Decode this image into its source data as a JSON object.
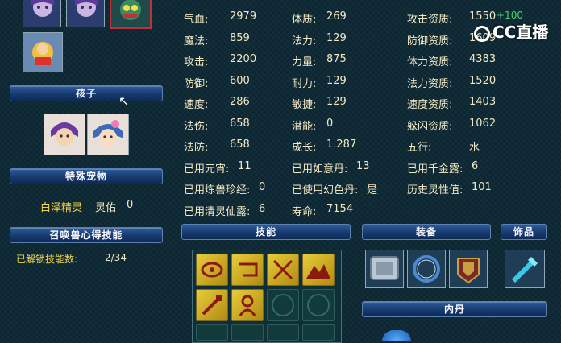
{
  "top_pet_tiles": [
    {
      "name": "pet-portrait-1"
    },
    {
      "name": "pet-portrait-2"
    },
    {
      "name": "pet-portrait-3-selected"
    },
    {
      "name": "pet-portrait-4"
    }
  ],
  "children_header": "孩子",
  "special_pet_header": "特殊宠物",
  "special_pet": {
    "name": "白泽精灵",
    "blessing_label": "灵佑",
    "blessing_value": "0"
  },
  "heart_skill_header": "召唤兽心得技能",
  "unlocked": {
    "label": "已解锁技能数:",
    "value": "2/34"
  },
  "stats_rows": [
    [
      {
        "label": "气血:",
        "value": "2979"
      },
      {
        "label": "体质:",
        "value": "269"
      },
      {
        "label": "攻击资质:",
        "value": "1550",
        "bonus": "+100"
      }
    ],
    [
      {
        "label": "魔法:",
        "value": "859"
      },
      {
        "label": "法力:",
        "value": "129"
      },
      {
        "label": "防御资质:",
        "value": "1609"
      }
    ],
    [
      {
        "label": "攻击:",
        "value": "2200"
      },
      {
        "label": "力量:",
        "value": "875"
      },
      {
        "label": "体力资质:",
        "value": "4383"
      }
    ],
    [
      {
        "label": "防御:",
        "value": "600"
      },
      {
        "label": "耐力:",
        "value": "129"
      },
      {
        "label": "法力资质:",
        "value": "1520"
      }
    ],
    [
      {
        "label": "速度:",
        "value": "286"
      },
      {
        "label": "敏捷:",
        "value": "129"
      },
      {
        "label": "速度资质:",
        "value": "1403"
      }
    ],
    [
      {
        "label": "法伤:",
        "value": "658"
      },
      {
        "label": "潜能:",
        "value": "0"
      },
      {
        "label": "躲闪资质:",
        "value": "1062"
      }
    ],
    [
      {
        "label": "法防:",
        "value": "658"
      },
      {
        "label": "成长:",
        "value": "1.287"
      },
      {
        "label": "五行:",
        "value": "水"
      }
    ],
    [
      {
        "label": "已用元宵:",
        "value": "11"
      },
      {
        "label": "已用如意丹:",
        "value": "13"
      },
      {
        "label": "已用千金露:",
        "value": "6"
      }
    ],
    [
      {
        "label": "已用炼兽珍经:",
        "value": "0"
      },
      {
        "label": "已使用幻色丹:",
        "value": "是"
      },
      {
        "label": "历史灵性值:",
        "value": "101"
      }
    ],
    [
      {
        "label": "已用清灵仙露:",
        "value": "6"
      },
      {
        "label": "寿命:",
        "value": "7154"
      },
      {
        "label": "",
        "value": ""
      }
    ]
  ],
  "skills_header": "技能",
  "equipment_header": "装备",
  "ornament_header": "饰品",
  "inner_dan_header": "内丹",
  "watermark": "CC直播",
  "colors": {
    "bonus": "#3cd66a",
    "text": "#f3e8c4",
    "highlight": "#f5d64a",
    "accent": "#c0303a"
  }
}
